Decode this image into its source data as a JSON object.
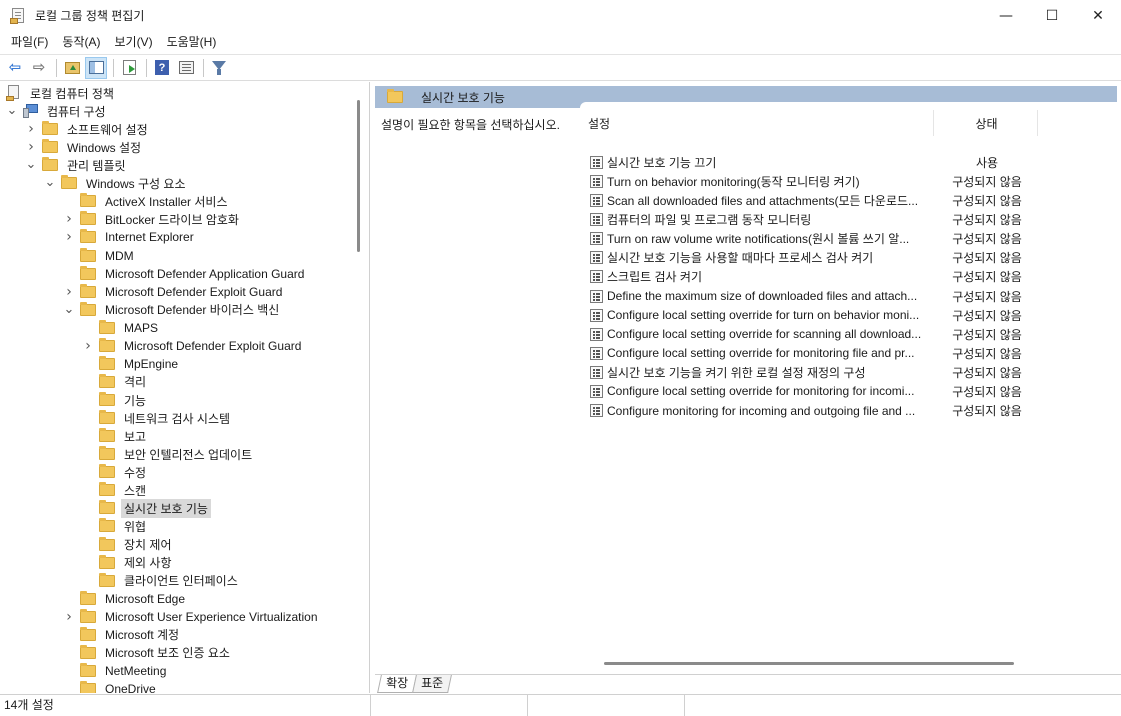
{
  "window": {
    "title": "로컬 그룹 정책 편집기",
    "controls": {
      "minimize": "—",
      "maximize": "☐",
      "close": "✕"
    }
  },
  "menu": [
    {
      "label": "파일(F)"
    },
    {
      "label": "동작(A)"
    },
    {
      "label": "보기(V)"
    },
    {
      "label": "도움말(H)"
    }
  ],
  "toolbar": {
    "buttons": [
      "back-icon",
      "forward-icon",
      "up-folder-icon",
      "show-hide-tree-icon",
      "export-list-icon",
      "help-icon",
      "properties-icon",
      "filter-icon"
    ]
  },
  "tree": {
    "items": [
      {
        "label": "로컬 컴퓨터 정책",
        "icon": "policy-icon",
        "level": 0,
        "chevron": ""
      },
      {
        "label": "컴퓨터 구성",
        "icon": "computer-icon",
        "level": 0,
        "chevron": "down"
      },
      {
        "label": "소프트웨어 설정",
        "icon": "folder-icon",
        "level": 1,
        "chevron": "right"
      },
      {
        "label": "Windows 설정",
        "icon": "folder-icon",
        "level": 1,
        "chevron": "right"
      },
      {
        "label": "관리 템플릿",
        "icon": "folder-icon",
        "level": 1,
        "chevron": "down"
      },
      {
        "label": "Windows 구성 요소",
        "icon": "folder-icon",
        "level": 2,
        "chevron": "down"
      },
      {
        "label": "ActiveX Installer 서비스",
        "icon": "folder-icon",
        "level": 3,
        "chevron": ""
      },
      {
        "label": "BitLocker 드라이브 암호화",
        "icon": "folder-icon",
        "level": 3,
        "chevron": "right"
      },
      {
        "label": "Internet Explorer",
        "icon": "folder-icon",
        "level": 3,
        "chevron": "right"
      },
      {
        "label": "MDM",
        "icon": "folder-icon",
        "level": 3,
        "chevron": ""
      },
      {
        "label": "Microsoft Defender Application Guard",
        "icon": "folder-icon",
        "level": 3,
        "chevron": ""
      },
      {
        "label": "Microsoft Defender Exploit Guard",
        "icon": "folder-icon",
        "level": 3,
        "chevron": "right"
      },
      {
        "label": "Microsoft Defender 바이러스 백신",
        "icon": "folder-icon",
        "level": 3,
        "chevron": "down"
      },
      {
        "label": "MAPS",
        "icon": "folder-icon",
        "level": 4,
        "chevron": ""
      },
      {
        "label": "Microsoft Defender Exploit Guard",
        "icon": "folder-icon",
        "level": 4,
        "chevron": "right"
      },
      {
        "label": "MpEngine",
        "icon": "folder-icon",
        "level": 4,
        "chevron": ""
      },
      {
        "label": "격리",
        "icon": "folder-icon",
        "level": 4,
        "chevron": ""
      },
      {
        "label": "기능",
        "icon": "folder-icon",
        "level": 4,
        "chevron": ""
      },
      {
        "label": "네트워크 검사 시스템",
        "icon": "folder-icon",
        "level": 4,
        "chevron": ""
      },
      {
        "label": "보고",
        "icon": "folder-icon",
        "level": 4,
        "chevron": ""
      },
      {
        "label": "보안 인텔리전스 업데이트",
        "icon": "folder-icon",
        "level": 4,
        "chevron": ""
      },
      {
        "label": "수정",
        "icon": "folder-icon",
        "level": 4,
        "chevron": ""
      },
      {
        "label": "스캔",
        "icon": "folder-icon",
        "level": 4,
        "chevron": ""
      },
      {
        "label": "실시간 보호 기능",
        "icon": "folder-icon",
        "level": 4,
        "chevron": "",
        "selected": true
      },
      {
        "label": "위협",
        "icon": "folder-icon",
        "level": 4,
        "chevron": ""
      },
      {
        "label": "장치 제어",
        "icon": "folder-icon",
        "level": 4,
        "chevron": ""
      },
      {
        "label": "제외 사항",
        "icon": "folder-icon",
        "level": 4,
        "chevron": ""
      },
      {
        "label": "클라이언트 인터페이스",
        "icon": "folder-icon",
        "level": 4,
        "chevron": ""
      },
      {
        "label": "Microsoft Edge",
        "icon": "folder-icon",
        "level": 3,
        "chevron": ""
      },
      {
        "label": "Microsoft User Experience Virtualization",
        "icon": "folder-icon",
        "level": 3,
        "chevron": "right"
      },
      {
        "label": "Microsoft 계정",
        "icon": "folder-icon",
        "level": 3,
        "chevron": ""
      },
      {
        "label": "Microsoft 보조 인증 요소",
        "icon": "folder-icon",
        "level": 3,
        "chevron": ""
      },
      {
        "label": "NetMeeting",
        "icon": "folder-icon",
        "level": 3,
        "chevron": ""
      },
      {
        "label": "OneDrive",
        "icon": "folder-icon",
        "level": 3,
        "chevron": ""
      }
    ]
  },
  "details": {
    "header_title": "실시간 보호 기능",
    "description": "설명이 필요한 항목을 선택하십시오.",
    "columns": {
      "setting": "설정",
      "state": "상태"
    },
    "rows": [
      {
        "name": "실시간 보호 기능 끄기",
        "state": "사용"
      },
      {
        "name": "Turn on behavior monitoring(동작 모니터링 켜기)",
        "state": "구성되지 않음"
      },
      {
        "name": "Scan all downloaded files and attachments(모든 다운로드...",
        "state": "구성되지 않음"
      },
      {
        "name": "컴퓨터의 파일 및 프로그램 동작 모니터링",
        "state": "구성되지 않음"
      },
      {
        "name": "Turn on raw volume write notifications(원시 볼륨 쓰기 알...",
        "state": "구성되지 않음"
      },
      {
        "name": "실시간 보호 기능을 사용할 때마다 프로세스 검사 켜기",
        "state": "구성되지 않음"
      },
      {
        "name": "스크립트 검사 켜기",
        "state": "구성되지 않음"
      },
      {
        "name": "Define the maximum size of downloaded files and attach...",
        "state": "구성되지 않음"
      },
      {
        "name": "Configure local setting override for turn on behavior moni...",
        "state": "구성되지 않음"
      },
      {
        "name": "Configure local setting override for scanning all download...",
        "state": "구성되지 않음"
      },
      {
        "name": "Configure local setting override for monitoring file and pr...",
        "state": "구성되지 않음"
      },
      {
        "name": "실시간 보호 기능을 켜기 위한 로컬 설정 재정의 구성",
        "state": "구성되지 않음"
      },
      {
        "name": "Configure local setting override for monitoring for incomi...",
        "state": "구성되지 않음"
      },
      {
        "name": "Configure monitoring for incoming and outgoing file and ...",
        "state": "구성되지 않음"
      }
    ]
  },
  "tabs": [
    {
      "label": "확장",
      "active": true
    },
    {
      "label": "표준",
      "active": false
    }
  ],
  "status": {
    "text": "14개 설정"
  }
}
